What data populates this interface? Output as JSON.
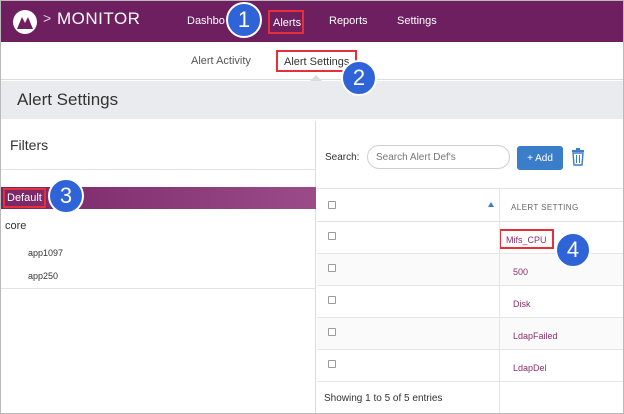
{
  "app": {
    "name": "MONITOR",
    "logo_icon": "monitor-logo-icon",
    "brand_color": "#6d1f5f"
  },
  "nav": {
    "items": [
      {
        "label": "Dashboard"
      },
      {
        "label": "Alerts"
      },
      {
        "label": "Reports"
      },
      {
        "label": "Settings"
      }
    ],
    "dashboard_visible": "Dashbo"
  },
  "subnav": {
    "items": [
      {
        "label": "Alert Activity"
      },
      {
        "label": "Alert Settings"
      }
    ]
  },
  "page": {
    "title": "Alert Settings"
  },
  "filters": {
    "title": "Filters",
    "tree": [
      {
        "label": "Default",
        "selected": true
      },
      {
        "label": "core"
      },
      {
        "label": "app1097"
      },
      {
        "label": "app250"
      }
    ]
  },
  "search": {
    "label": "Search:",
    "placeholder": "Search Alert Def's"
  },
  "toolbar": {
    "add_label": "+ Add",
    "accent": "#3a7dc9"
  },
  "table": {
    "column": "ALERT SETTING",
    "rows": [
      "Mifs_CPU",
      "500",
      "Disk",
      "LdapFailed",
      "LdapDel"
    ],
    "footer": "Showing 1 to 5 of 5 entries"
  },
  "callouts": [
    "1",
    "2",
    "3",
    "4"
  ]
}
